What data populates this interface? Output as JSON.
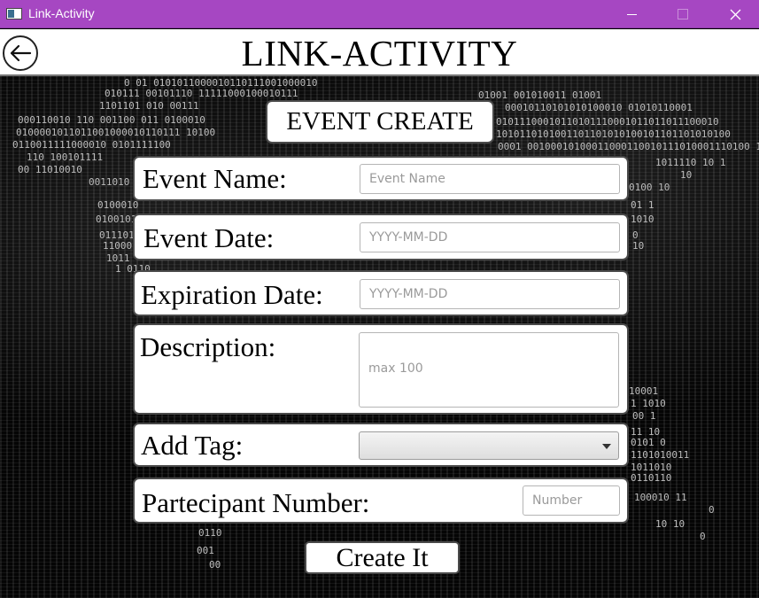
{
  "window": {
    "title": "Link-Activity"
  },
  "header": {
    "title": "LINK-ACTIVITY"
  },
  "form": {
    "title": "EVENT CREATE",
    "event_name": {
      "label": "Event Name:",
      "placeholder": "Event Name",
      "value": ""
    },
    "event_date": {
      "label": "Event Date:",
      "placeholder": "YYYY-MM-DD",
      "value": ""
    },
    "expiration_date": {
      "label": "Expiration Date:",
      "placeholder": "YYYY-MM-DD",
      "value": ""
    },
    "description": {
      "label": "Description:",
      "placeholder": "max 100",
      "value": ""
    },
    "add_tag": {
      "label": "Add Tag:",
      "selected": ""
    },
    "participant_number": {
      "label": "Partecipant Number:",
      "placeholder": "Number",
      "value": ""
    },
    "submit_label": "Create It"
  },
  "icons": {
    "back": "arrow-left-icon",
    "minimize": "minimize-icon",
    "maximize": "maximize-icon",
    "close": "close-icon",
    "dropdown": "chevron-down-icon"
  },
  "colors": {
    "titlebar": "#a647c2",
    "background": "#050505",
    "panel": "#ffffff",
    "panel_border": "#4a4a4a"
  }
}
